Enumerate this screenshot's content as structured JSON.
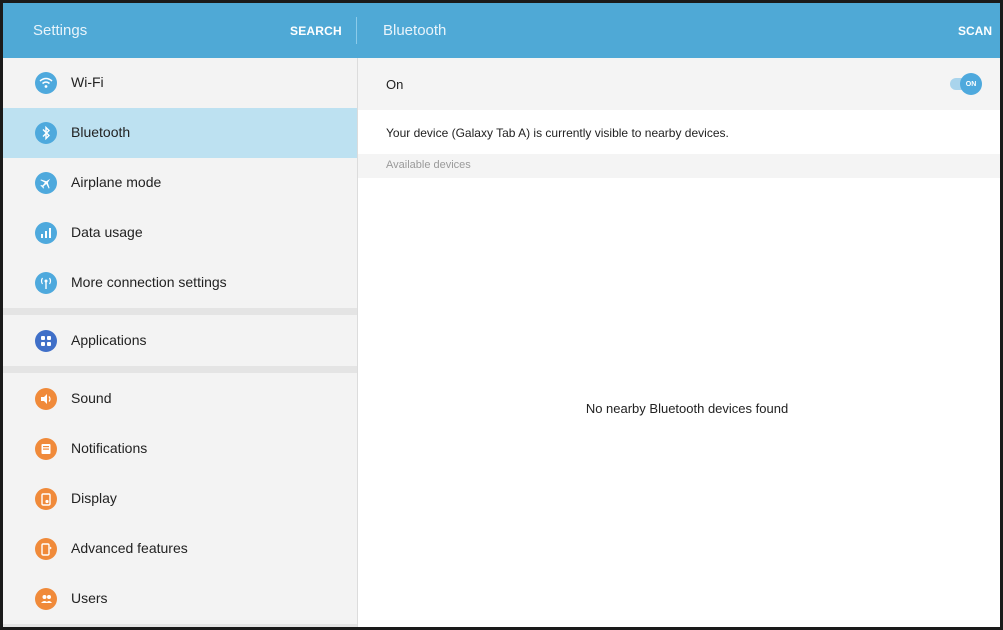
{
  "header": {
    "left_title": "Settings",
    "search_label": "SEARCH",
    "right_title": "Bluetooth",
    "scan_label": "SCAN"
  },
  "sidebar": {
    "items": [
      {
        "label": "Wi-Fi",
        "icon": "wifi-icon"
      },
      {
        "label": "Bluetooth",
        "icon": "bluetooth-icon",
        "selected": true
      },
      {
        "label": "Airplane mode",
        "icon": "airplane-icon"
      },
      {
        "label": "Data usage",
        "icon": "data-usage-icon"
      },
      {
        "label": "More connection settings",
        "icon": "connection-settings-icon"
      },
      {
        "label": "Applications",
        "icon": "applications-icon"
      },
      {
        "label": "Sound",
        "icon": "sound-icon"
      },
      {
        "label": "Notifications",
        "icon": "notifications-icon"
      },
      {
        "label": "Display",
        "icon": "display-icon"
      },
      {
        "label": "Advanced features",
        "icon": "advanced-features-icon"
      },
      {
        "label": "Users",
        "icon": "users-icon"
      }
    ]
  },
  "bluetooth": {
    "switch_label": "On",
    "toggle_text": "ON",
    "toggle_state": "on",
    "visibility_message": "Your device (Galaxy Tab A) is currently visible to nearby devices.",
    "available_header": "Available devices",
    "empty_message": "No nearby Bluetooth devices found"
  },
  "colors": {
    "app_bar": "#4fa9d6",
    "selected_row": "#bde1f1",
    "icon_blue": "#4ea9dd",
    "icon_navy": "#3f6fc8",
    "icon_orange": "#f08a3a"
  }
}
